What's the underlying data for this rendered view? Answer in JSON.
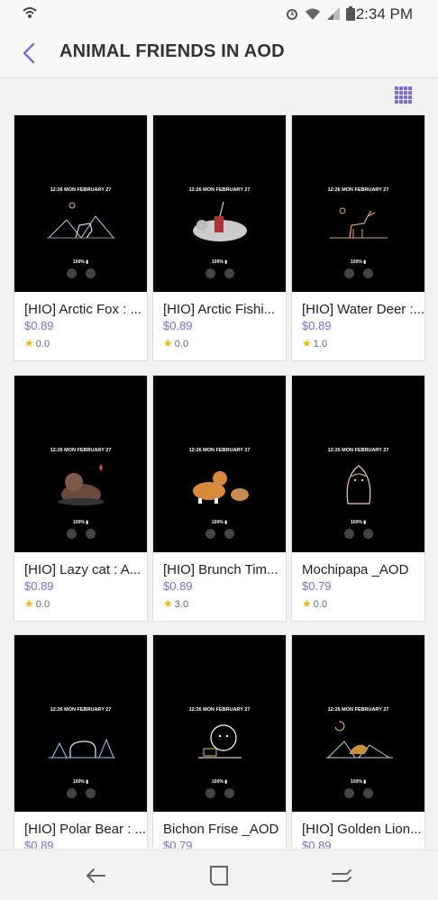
{
  "status": {
    "time": "2:34 PM"
  },
  "header": {
    "title": "ANIMAL FRIENDS IN AOD"
  },
  "aod_preview": {
    "clock": "12:26  MON FEBRUARY 27",
    "battery": "100% ▮"
  },
  "items": [
    {
      "name": "[HIO] Arctic Fox : ...",
      "price": "$0.89",
      "rating": "0.0",
      "art": "fox"
    },
    {
      "name": "[HIO] Arctic Fishi...",
      "price": "$0.89",
      "rating": "0.0",
      "art": "bear-fish"
    },
    {
      "name": "[HIO] Water Deer :...",
      "price": "$0.89",
      "rating": "1.0",
      "art": "deer"
    },
    {
      "name": "[HIO] Lazy cat : A...",
      "price": "$0.89",
      "rating": "0.0",
      "art": "cat"
    },
    {
      "name": "[HIO] Brunch Tim...",
      "price": "$0.89",
      "rating": "3.0",
      "art": "corgi"
    },
    {
      "name": "Mochipapa _AOD",
      "price": "$0.79",
      "rating": "0.0",
      "art": "mochi"
    },
    {
      "name": "[HIO] Polar Bear : ...",
      "price": "$0.89",
      "rating": "",
      "art": "polar"
    },
    {
      "name": "Bichon Frise _AOD",
      "price": "$0.79",
      "rating": "",
      "art": "bichon"
    },
    {
      "name": "[HIO] Golden Lion...",
      "price": "$0.89",
      "rating": "",
      "art": "lion"
    }
  ],
  "colors": {
    "accent": "#7a6be0",
    "star": "#f5b800"
  }
}
